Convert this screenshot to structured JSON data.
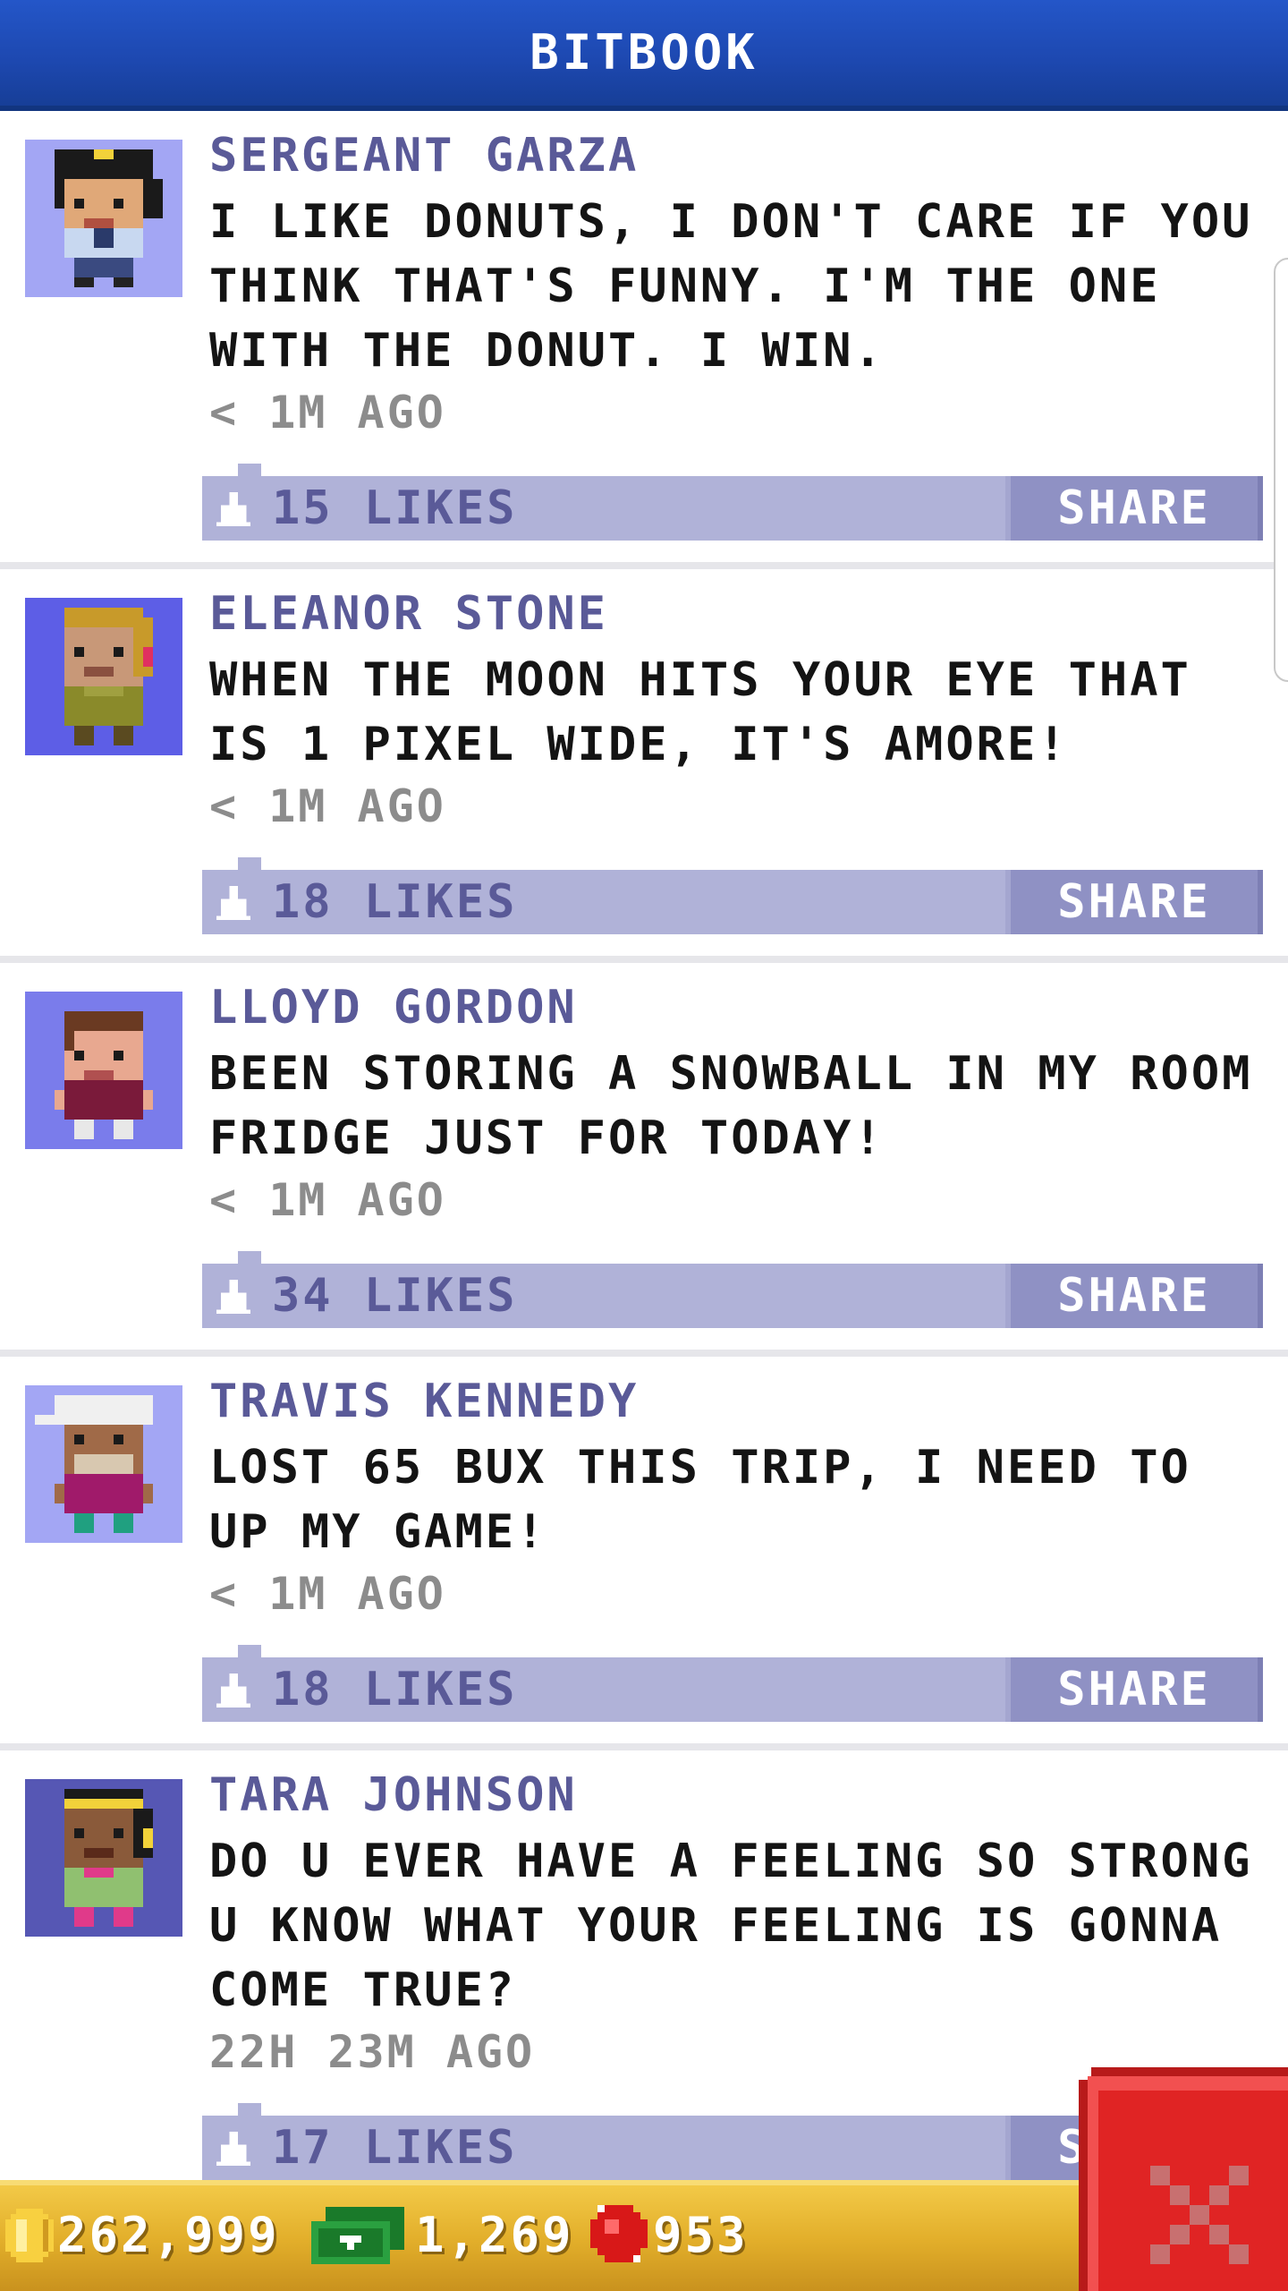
{
  "header": {
    "title": "BITBOOK"
  },
  "posts": [
    {
      "name": "SERGEANT GARZA",
      "text": "I LIKE DONUTS, I DON'T CARE IF YOU THINK THAT'S FUNNY. I'M THE ONE WITH THE DONUT. I WIN.",
      "time": "< 1M AGO",
      "likes": "15 LIKES",
      "share": "SHARE",
      "avatar_bg": "#a3a6f4"
    },
    {
      "name": "ELEANOR STONE",
      "text": "WHEN THE MOON HITS YOUR EYE THAT IS 1 PIXEL WIDE, IT'S AMORE!",
      "time": "< 1M AGO",
      "likes": "18 LIKES",
      "share": "SHARE",
      "avatar_bg": "#5d5ee6"
    },
    {
      "name": "LLOYD GORDON",
      "text": "BEEN STORING A SNOWBALL IN MY ROOM FRIDGE JUST FOR TODAY!",
      "time": "< 1M AGO",
      "likes": "34 LIKES",
      "share": "SHARE",
      "avatar_bg": "#7a7ceb"
    },
    {
      "name": "TRAVIS KENNEDY",
      "text": "LOST 65 BUX THIS TRIP, I NEED TO UP MY GAME!",
      "time": "< 1M AGO",
      "likes": "18 LIKES",
      "share": "SHARE",
      "avatar_bg": "#a3a6f4"
    },
    {
      "name": "TARA JOHNSON",
      "text": "DO U EVER HAVE A FEELING SO STRONG U KNOW WHAT YOUR FEELING IS GONNA COME TRUE?",
      "time": "22H 23M AGO",
      "likes": "17 LIKES",
      "share": "SHARE",
      "avatar_bg": "#5657b4"
    }
  ],
  "currencies": {
    "coins": "262,999",
    "bux": "1,269",
    "gems": "953"
  },
  "colors": {
    "header": "#1d48b0",
    "bottom_bar": "#e2ae2a",
    "like_bar": "#b0b2d8",
    "share_button": "#8f91c4",
    "name_text": "#5a5a98",
    "close_button": "#e02424"
  },
  "icons": {
    "like": "thumbs-up-icon",
    "coin": "coin-icon",
    "bux": "bux-icon",
    "gem": "gem-icon",
    "close": "close-icon"
  }
}
